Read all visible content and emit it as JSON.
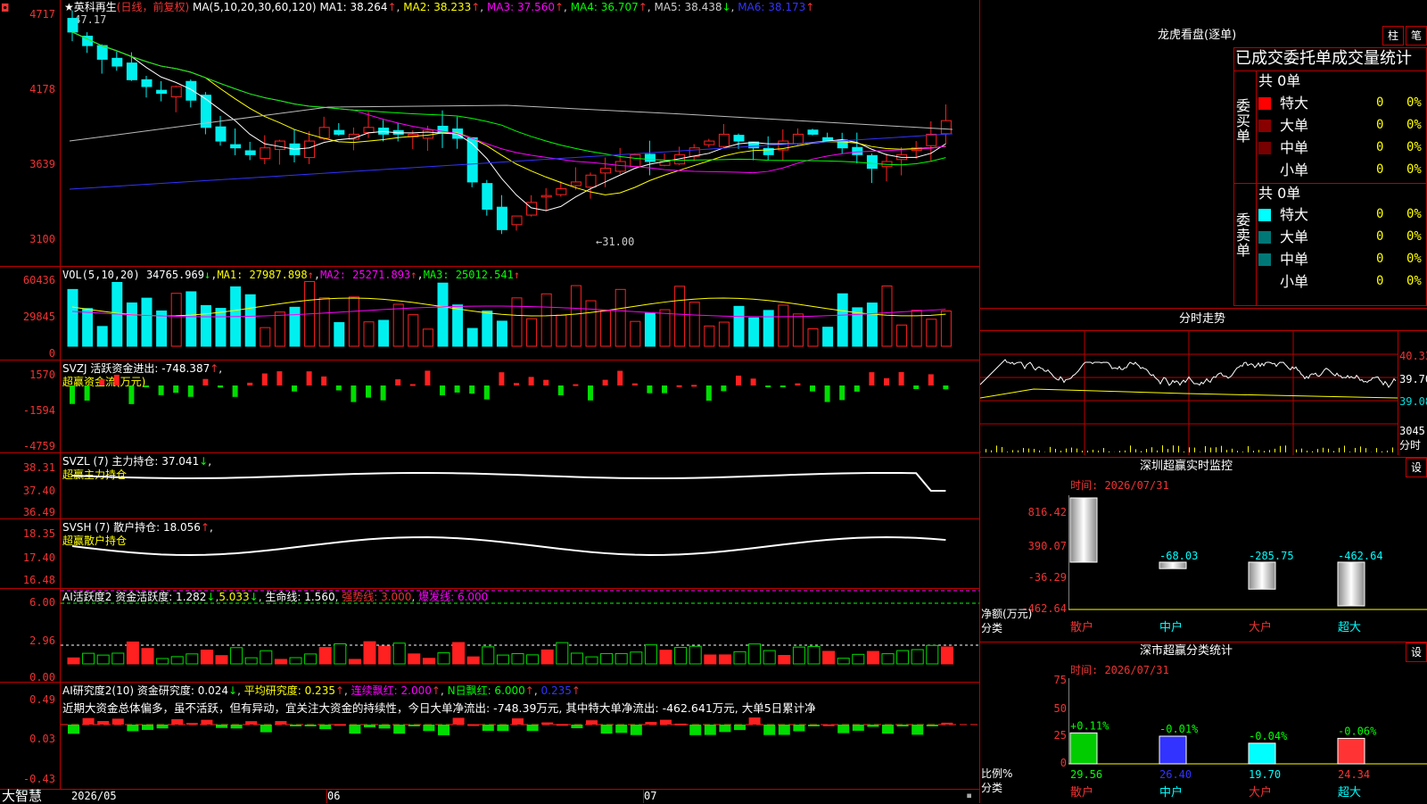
{
  "colors": {
    "up": "#ff2020",
    "down": "#00f0f0",
    "frame": "#b00000",
    "green": "#00dd00"
  },
  "title": {
    "star": "★",
    "name": "英科再生",
    "period": "(日线，前复权)",
    "ma_label": "MA(5,10,20,30,60,120)",
    "ma1": "MA1: 38.264",
    "ma2": "MA2: 38.233",
    "ma3": "MA3: 37.560",
    "ma4": "MA4: 36.707",
    "ma5": "MA5: 38.438",
    "ma6": "MA6: 38.173",
    "hi_mark": "←47.17",
    "lo_mark": "←31.00"
  },
  "axes": {
    "price": [
      "4717",
      "4178",
      "3639",
      "3100"
    ],
    "vol": [
      "60436",
      "29845",
      "0"
    ],
    "svzj": [
      "1570",
      "-1594",
      "-4759"
    ],
    "svzl": [
      "38.31",
      "37.40",
      "36.49"
    ],
    "svsh": [
      "18.35",
      "17.40",
      "16.48"
    ],
    "ai1": [
      "6.00",
      "2.96",
      "0.00"
    ],
    "ai2": [
      "0.49",
      "0.03",
      "-0.43"
    ]
  },
  "vol": {
    "label": "VOL(5,10,20)",
    "value": "34765.969",
    "ma1": "MA1: 27987.898",
    "ma2": "MA2: 25271.893",
    "ma3": "MA3: 25012.541"
  },
  "svzj": {
    "label": "SVZJ  活跃资金进出: -748.387",
    "sub": "超赢资金流(万元)"
  },
  "svzl": {
    "label": "SVZL (7) 主力持仓: 37.041",
    "sub": "超赢主力持仓"
  },
  "svsh": {
    "label": "SVSH (7) 散户持仓: 18.056",
    "sub": "超赢散户持仓"
  },
  "ai1": {
    "a": "AI活跃度2 资金活跃度: 1.282",
    "b": "5.033",
    "c": "生命线: 1.560",
    "d": "强势线: 3.000",
    "e": "爆发线: 6.000"
  },
  "ai2": {
    "a": "AI研究度2(10) 资金研究度: 0.024",
    "b": "平均研究度: 0.235",
    "c": "连续飘红: 2.000",
    "d": "N日飘红: 6.000",
    "e": "0.235",
    "note": "近期大资金总体偏多，虽不活跃，但有异动，宜关注大资金的持续性，今日大单净流出: -748.39万元, 其中特大单净流出: -462.641万元, 大单5日累计净"
  },
  "bottom": {
    "brand": "大智慧",
    "d1": "2026/05",
    "d2": "06",
    "d3": "07"
  },
  "lhb": {
    "title": "龙虎看盘(逐单)",
    "btn1": "柱",
    "btn2": "笔",
    "tabs": "已成交委托单成交量统计",
    "buy_total": "共 0单",
    "sell_total": "共 0单",
    "buy_side": "委买单",
    "sell_side": "委卖单",
    "rows": [
      {
        "name": "特大",
        "v": "0",
        "p": "0%"
      },
      {
        "name": "大单",
        "v": "0",
        "p": "0%"
      },
      {
        "name": "中单",
        "v": "0",
        "p": "0%"
      },
      {
        "name": "小单",
        "v": "0",
        "p": "0%"
      }
    ]
  },
  "fs": {
    "title": "分时走势",
    "y": [
      "40.33",
      "39.70",
      "39.08"
    ],
    "vol": "3045",
    "unit": "分时"
  },
  "mon": {
    "title": "深圳超赢实时监控",
    "btn": "设",
    "time": "时间: 2026/07/31",
    "y": [
      "816.42",
      "390.07",
      "-36.29",
      "-462.64"
    ],
    "ylabel": "净额(万元)",
    "xlabel": "分类",
    "bars": [
      {
        "cat": "散户",
        "v": "816.42"
      },
      {
        "cat": "中户",
        "v": "-68.03"
      },
      {
        "cat": "大户",
        "v": "-285.75"
      },
      {
        "cat": "超大",
        "v": "-462.64"
      }
    ]
  },
  "cls": {
    "title": "深市超赢分类统计",
    "btn": "设",
    "time": "时间: 2026/07/31",
    "y": [
      "75",
      "50",
      "25",
      "0"
    ],
    "ylabel": "比例%",
    "xlabel": "分类",
    "bars": [
      {
        "cat": "散户",
        "top": "+0.11%",
        "v": "29.56"
      },
      {
        "cat": "中户",
        "top": "-0.01%",
        "v": "26.40"
      },
      {
        "cat": "大户",
        "top": "-0.04%",
        "v": "19.70"
      },
      {
        "cat": "超大",
        "top": "-0.06%",
        "v": "24.34"
      }
    ]
  }
}
